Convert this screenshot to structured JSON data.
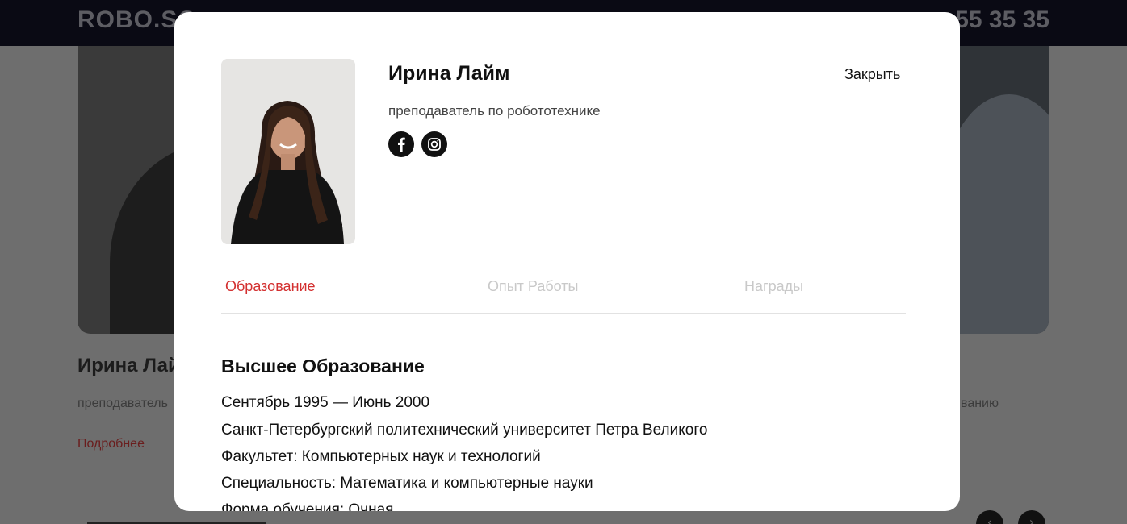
{
  "background": {
    "logo": "ROBO.SC",
    "phone": "55 35 35",
    "card_name": "Ирина Лай",
    "card_role": "преподаватель",
    "card_role_right": "ванию",
    "card_more": "Подробнее"
  },
  "modal": {
    "name": "Ирина Лайм",
    "role": "преподаватель по робототехнике",
    "close_label": "Закрыть",
    "social": [
      {
        "icon": "facebook-icon"
      },
      {
        "icon": "instagram-icon"
      }
    ],
    "tabs": [
      {
        "label": "Образование",
        "active": true
      },
      {
        "label": "Опыт Работы",
        "active": false
      },
      {
        "label": "Награды",
        "active": false
      }
    ],
    "education": {
      "title": "Высшее Образование",
      "lines": [
        "Сентябрь 1995 — Июнь 2000",
        "Санкт-Петербургский политехнический университет Петра Великого",
        "Факультет: Компьютерных наук и технологий",
        "Специальность: Математика и компьютерные науки",
        "Форма обучения: Очная"
      ]
    }
  },
  "colors": {
    "accent": "#d32f2f",
    "dark": "#111111",
    "tab_inactive": "#c9c9c9"
  }
}
